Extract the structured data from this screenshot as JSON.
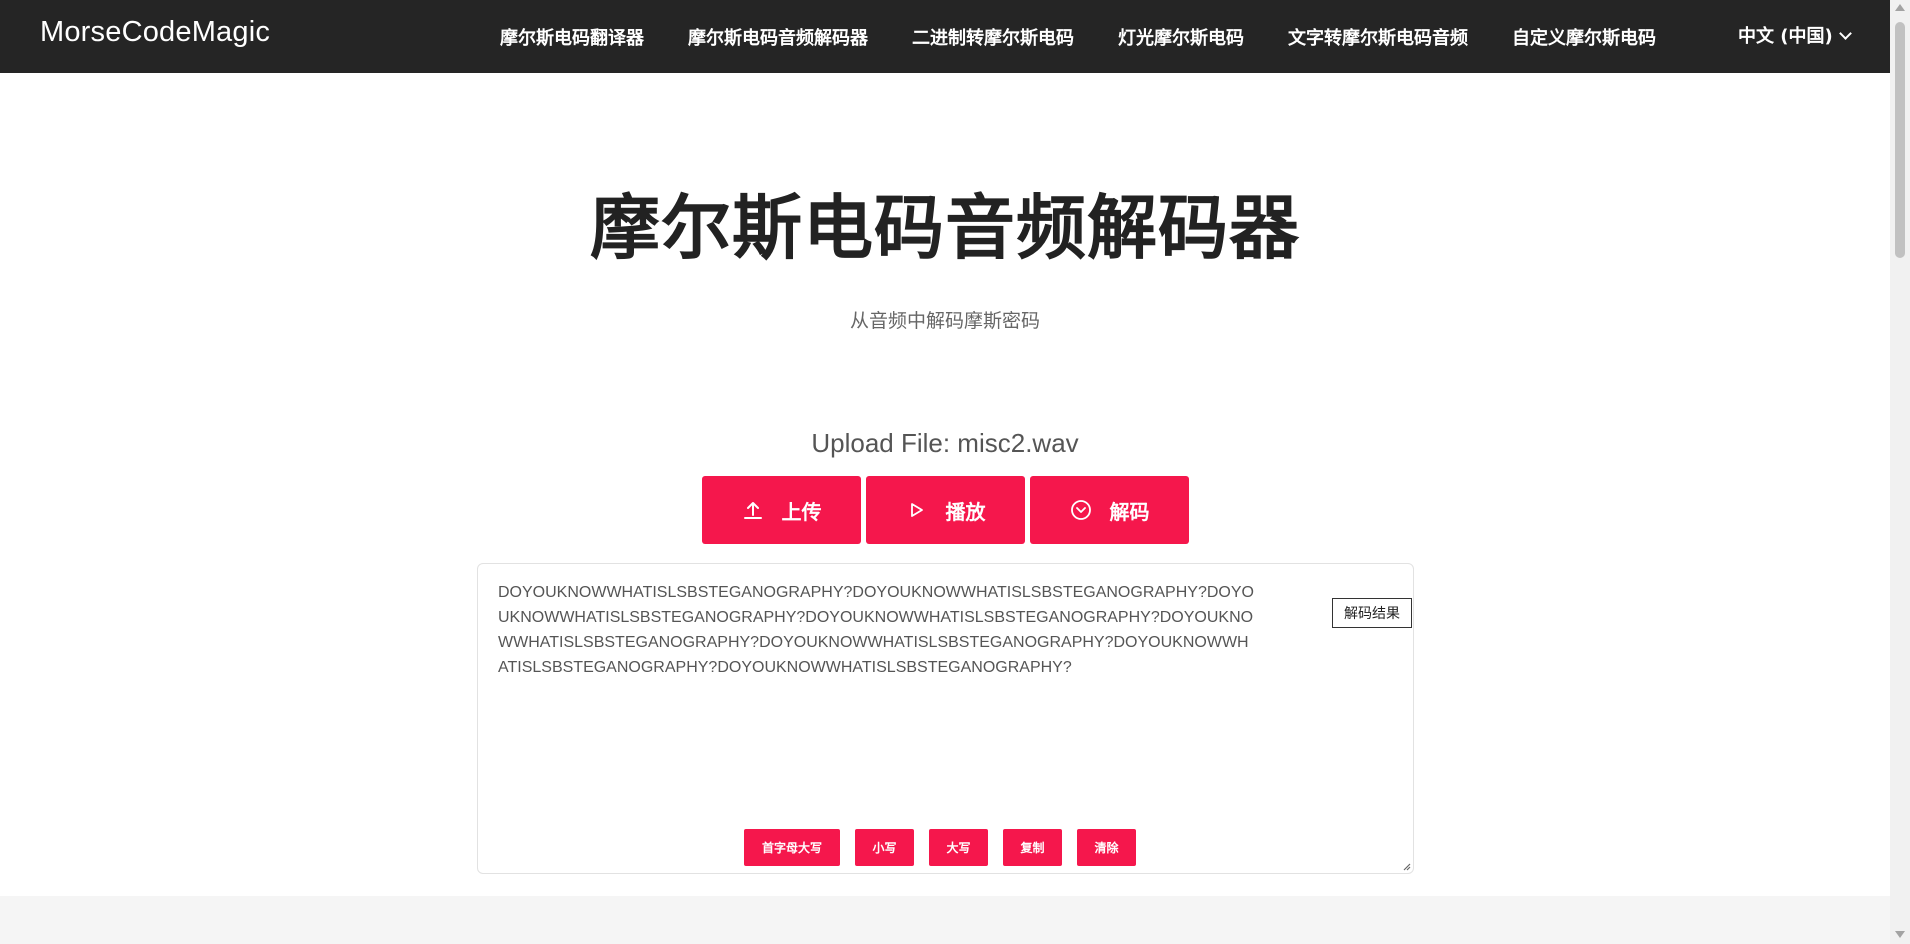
{
  "nav": {
    "brand": "MorseCodeMagic",
    "items": [
      {
        "label": "摩尔斯电码翻译器"
      },
      {
        "label": "摩尔斯电码音频解码器"
      },
      {
        "label": "二进制转摩尔斯电码"
      },
      {
        "label": "灯光摩尔斯电码"
      },
      {
        "label": "文字转摩尔斯电码音频"
      },
      {
        "label": "自定义摩尔斯电码"
      }
    ],
    "language": "中文 (中国)"
  },
  "hero": {
    "title": "摩尔斯电码音频解码器",
    "subtitle": "从音频中解码摩斯密码"
  },
  "upload": {
    "label": "Upload File: misc2.wav"
  },
  "actions": {
    "upload_label": "上传",
    "play_label": "播放",
    "decode_label": "解码"
  },
  "result": {
    "tag": "解码结果",
    "text": "DOYOUKNOWWHATISLSBSTEGANOGRAPHY?DOYOUKNOWWHATISLSBSTEGANOGRAPHY?DOYOUKNOWWHATISLSBSTEGANOGRAPHY?DOYOUKNOWWHATISLSBSTEGANOGRAPHY?DOYOUKNOWWHATISLSBSTEGANOGRAPHY?DOYOUKNOWWHATISLSBSTEGANOGRAPHY?DOYOUKNOWWHATISLSBSTEGANOGRAPHY?DOYOUKNOWWHATISLSBSTEGANOGRAPHY?"
  },
  "text_tools": {
    "capitalize_label": "首字母大写",
    "lowercase_label": "小写",
    "uppercase_label": "大写",
    "copy_label": "复制",
    "clear_label": "清除"
  },
  "colors": {
    "accent": "#f5174c",
    "navbar": "#252525"
  }
}
